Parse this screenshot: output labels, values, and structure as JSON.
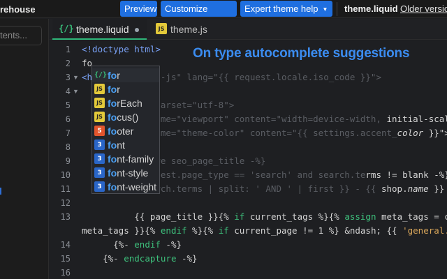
{
  "topbar": {
    "store_name": "rehouse",
    "preview_label": "Preview",
    "customize_label": "Customize theme",
    "expert_label": "Expert theme help",
    "file_title": "theme.liquid",
    "older_versions_label": "Older versions"
  },
  "sidebar": {
    "search_placeholder": "tents..."
  },
  "tabs": [
    {
      "label": "theme.liquid",
      "icon": "{/}",
      "active": true
    },
    {
      "label": "theme.js",
      "icon": "JS",
      "active": false
    }
  ],
  "caption": "On type autocomplete suggestions",
  "editor": {
    "line_numbers": [
      "1",
      "2",
      "3",
      "4",
      "5",
      "6",
      "7",
      "8",
      "9",
      "10",
      "11",
      "12",
      "13",
      "",
      "14",
      "15",
      "16",
      "17",
      "18"
    ],
    "typed": "fo"
  },
  "suggestions": [
    {
      "match": "fo",
      "rest": "r",
      "icon": "{/}",
      "kind": "liquid"
    },
    {
      "match": "fo",
      "rest": "r",
      "icon": "JS",
      "kind": "js"
    },
    {
      "match": "fo",
      "rest": "rEach",
      "icon": "JS",
      "kind": "js"
    },
    {
      "match": "fo",
      "rest": "cus()",
      "icon": "JS",
      "kind": "js"
    },
    {
      "match": "fo",
      "rest": "oter",
      "icon": "5",
      "kind": "html"
    },
    {
      "match": "fo",
      "rest": "nt",
      "icon": "3",
      "kind": "css"
    },
    {
      "match": "fo",
      "rest": "nt-family",
      "icon": "3",
      "kind": "css"
    },
    {
      "match": "fo",
      "rest": "nt-style",
      "icon": "3",
      "kind": "css"
    },
    {
      "match": "fo",
      "rest": "nt-weight",
      "icon": "3",
      "kind": "css"
    }
  ],
  "colors": {
    "accent_blue": "#1f6fe0",
    "caption_blue": "#3b8cf0",
    "liquid_green": "#39c17c"
  }
}
